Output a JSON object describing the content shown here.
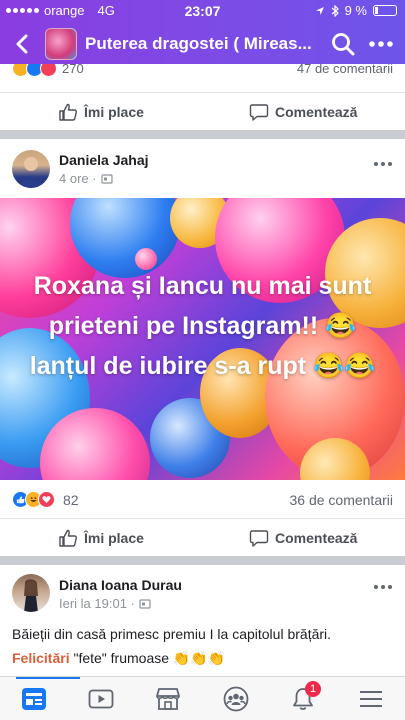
{
  "status_bar": {
    "carrier": "orange",
    "network": "4G",
    "time": "23:07",
    "battery": "9 %"
  },
  "nav": {
    "title": "Puterea dragostei ( Mireas...",
    "back_icon": "chevron-left-icon",
    "search_icon": "search-icon",
    "more_icon": "more-dots-icon"
  },
  "previous_post": {
    "reaction_count": "270",
    "comments": "47 de comentarii"
  },
  "actions": {
    "like": "Îmi place",
    "comment": "Comentează"
  },
  "posts": [
    {
      "author": "Daniela Jahaj",
      "time": "4 ore ·",
      "banner_text": "Roxana și Iancu nu mai sunt prieteni pe Instagram!! 😂lanțul de iubire s-a rupt 😂😂",
      "reaction_count": "82",
      "comments": "36 de comentarii"
    },
    {
      "author": "Diana Ioana Durau",
      "time": "Ieri la 19:01 ·",
      "text_line1": "Băieții din casă primesc premiu I la capitolul brățări.",
      "text_highlight": "Felicitări",
      "text_line2": " \"fete\" frumoase 👏👏👏"
    }
  ],
  "tabbar": {
    "tabs": [
      "news-feed-icon",
      "watch-icon",
      "marketplace-icon",
      "groups-icon",
      "notifications-icon",
      "menu-icon"
    ],
    "notification_badge": "1"
  },
  "colors": {
    "header_start": "#8a3de0",
    "header_end": "#6e55ea",
    "like_blue": "#1877f2",
    "love_red": "#f33e58",
    "felicitari": "#d9603b",
    "separator": "#c9ccd1"
  }
}
